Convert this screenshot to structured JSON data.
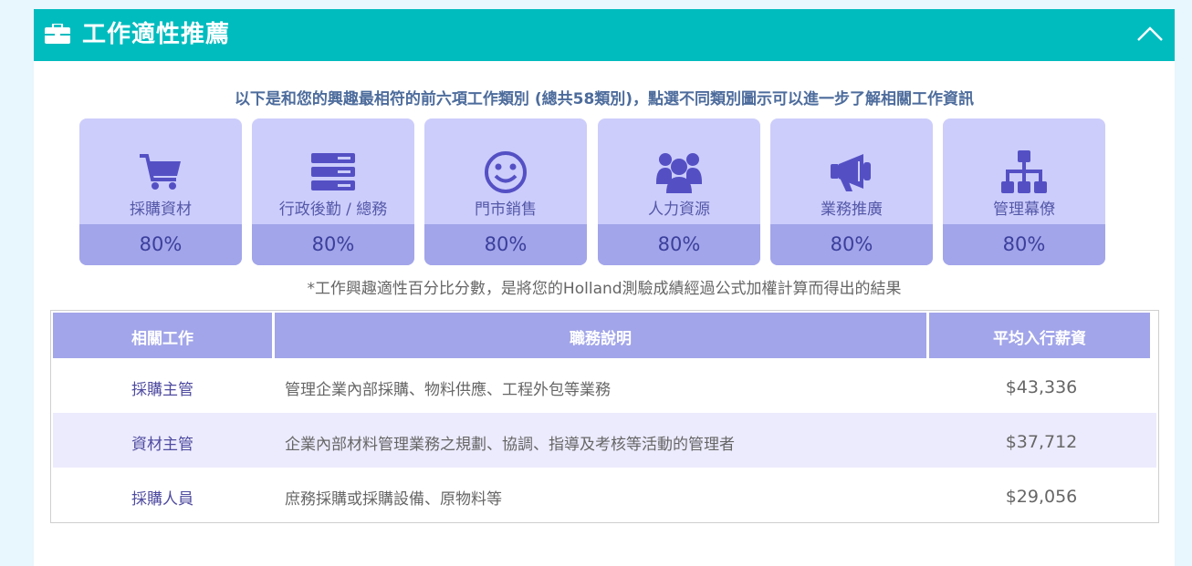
{
  "header": {
    "title": "工作適性推薦",
    "briefcase_icon": "briefcase-icon",
    "collapse_icon": "chevron-up-icon",
    "color": "#00bcbf"
  },
  "intro": "以下是和您的興趣最相符的前六項工作類別 (總共58類別)，點選不同類別圖示可以進一步了解相關工作資訊",
  "categories": [
    {
      "name": "採購資材",
      "icon": "shopping-cart-icon",
      "percent": "80%"
    },
    {
      "name": "行政後勤 / 總務",
      "icon": "server-stack-icon",
      "percent": "80%"
    },
    {
      "name": "門市銷售",
      "icon": "smile-icon",
      "percent": "80%"
    },
    {
      "name": "人力資源",
      "icon": "users-icon",
      "percent": "80%"
    },
    {
      "name": "業務推廣",
      "icon": "megaphone-icon",
      "percent": "80%"
    },
    {
      "name": "管理幕僚",
      "icon": "org-chart-icon",
      "percent": "80%"
    }
  ],
  "note": "*工作興趣適性百分比分數，是將您的Holland測驗成績經過公式加權計算而得出的結果",
  "table": {
    "headers": [
      "相關工作",
      "職務說明",
      "平均入行薪資"
    ],
    "rows": [
      {
        "job": "採購主管",
        "desc": "管理企業內部採購、物料供應、工程外包等業務",
        "salary": "$43,336"
      },
      {
        "job": "資材主管",
        "desc": "企業內部材料管理業務之規劃、協調、指導及考核等活動的管理者",
        "salary": "$37,712"
      },
      {
        "job": "採購人員",
        "desc": "庶務採購或採購設備、原物料等",
        "salary": "$29,056"
      }
    ]
  },
  "colors": {
    "card_bg": "#cccdfb",
    "card_percent_bg": "#a2a5e9",
    "icon": "#5450c4",
    "table_header": "#a2a5e9",
    "row_alt": "#ecebfd"
  }
}
